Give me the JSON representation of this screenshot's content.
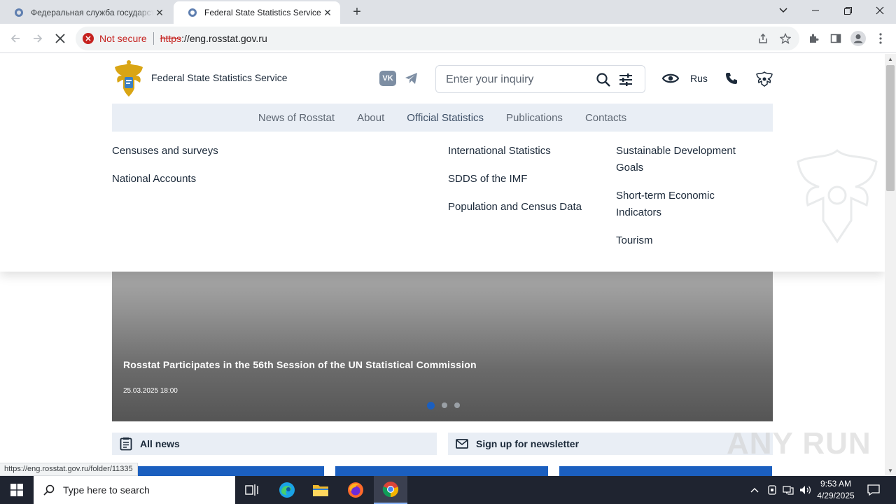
{
  "browser": {
    "tabs": [
      {
        "title": "Федеральная служба государственной статистики",
        "active": false
      },
      {
        "title": "Federal State Statistics Service",
        "active": true
      }
    ],
    "new_tab": "+",
    "security_label": "Not secure",
    "url_scheme": "https",
    "url_rest": "://eng.rosstat.gov.ru",
    "status_url": "https://eng.rosstat.gov.ru/folder/11335"
  },
  "site": {
    "name": "Federal State Statistics Service",
    "vk": "VK",
    "search_placeholder": "Enter your inquiry",
    "language": "Rus",
    "nav": [
      "News of Rosstat",
      "About",
      "Official Statistics",
      "Publications",
      "Contacts"
    ],
    "active_nav": "Official Statistics",
    "submenu": {
      "col1": [
        "Censuses and surveys",
        "National Accounts"
      ],
      "col2": [
        "International Statistics",
        "SDDS of the IMF",
        "Population and Census Data"
      ],
      "col3": [
        "Sustainable Development Goals",
        "Short-term Economic Indicators",
        "Tourism"
      ]
    },
    "hero": {
      "title": "Rosstat Participates in the 56th Session of the UN Statistical Commission",
      "date": "25.03.2025 18:00",
      "slides": 3,
      "active_slide": 1
    },
    "all_news": "All news",
    "newsletter": "Sign up for newsletter",
    "accent_color": "#1b5fbf"
  },
  "watermark": "ANY RUN",
  "taskbar": {
    "search_placeholder": "Type here to search",
    "time": "9:53 AM",
    "date": "4/29/2025"
  }
}
